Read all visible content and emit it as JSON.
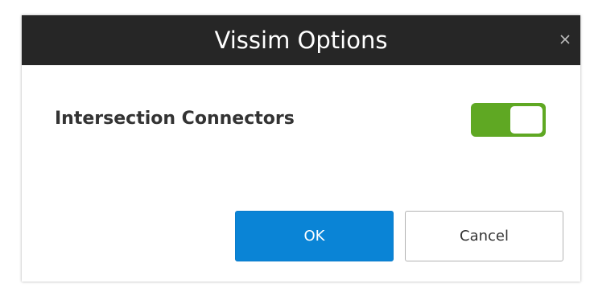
{
  "dialog": {
    "title": "Vissim Options",
    "close_icon": "close-icon",
    "close_glyph": "×"
  },
  "options": [
    {
      "label": "Intersection Connectors",
      "toggle_on": true
    }
  ],
  "buttons": {
    "ok_label": "OK",
    "cancel_label": "Cancel"
  },
  "colors": {
    "title_bar": "#262626",
    "toggle_on": "#5fa823",
    "primary_button": "#0a84d6"
  }
}
